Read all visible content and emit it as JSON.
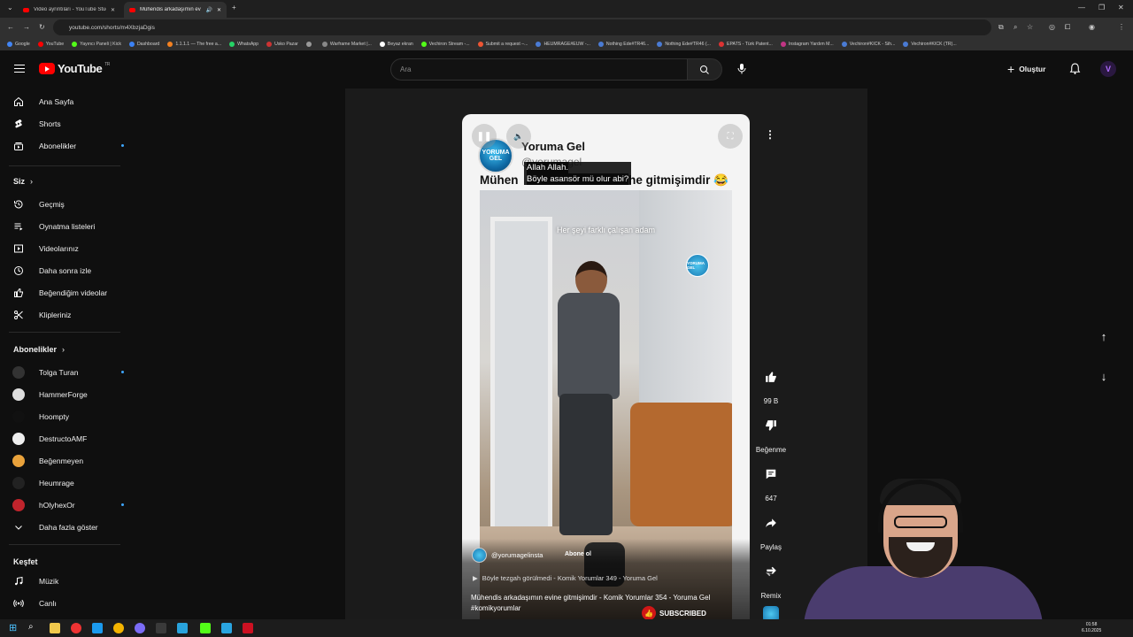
{
  "browser": {
    "tabs": [
      {
        "label": "Video ayrıntıları - YouTube Stud"
      },
      {
        "label": "Mühendis arkadaşımın evin"
      }
    ],
    "url": "youtube.com/shorts/m4XbzjaDgis",
    "bookmarks": [
      {
        "label": "Google",
        "color": "#4285f4"
      },
      {
        "label": "YouTube",
        "color": "#ff0000"
      },
      {
        "label": "Yayıncı Paneli | Kick",
        "color": "#53fc18"
      },
      {
        "label": "Dashboard",
        "color": "#3b82f6"
      },
      {
        "label": "1.1.1.1 — The free a...",
        "color": "#f48120"
      },
      {
        "label": "WhatsApp",
        "color": "#25d366"
      },
      {
        "label": "Usko Pazar",
        "color": "#c33"
      },
      {
        "label": "",
        "color": "#999"
      },
      {
        "label": "Warframe Market |...",
        "color": "#888"
      },
      {
        "label": "Beyaz ekran",
        "color": "#fff"
      },
      {
        "label": "Vechiron Stream -...",
        "color": "#53fc18"
      },
      {
        "label": "Submit a request –...",
        "color": "#e53"
      },
      {
        "label": "HEUMRAGE#EUW -...",
        "color": "#4a7bd4"
      },
      {
        "label": "Nothing Ede#TR46...",
        "color": "#4a7bd4"
      },
      {
        "label": "Nothing Ede#TR46 (...",
        "color": "#4a7bd4"
      },
      {
        "label": "EPATS - Türk Patent...",
        "color": "#d33"
      },
      {
        "label": "Instagram Yardım M...",
        "color": "#c13584"
      },
      {
        "label": "Vechiron#KICK - Sih...",
        "color": "#4a7bd4"
      },
      {
        "label": "Vechiron#KICK (TR)...",
        "color": "#4a7bd4"
      }
    ]
  },
  "header": {
    "logo_text": "YouTube",
    "region": "TR",
    "search_placeholder": "Ara",
    "create_label": "Oluştur",
    "avatar_letter": "V"
  },
  "sidebar": {
    "main": [
      {
        "label": "Ana Sayfa",
        "icon": "home-icon"
      },
      {
        "label": "Shorts",
        "icon": "shorts-icon"
      },
      {
        "label": "Abonelikler",
        "icon": "subscriptions-icon"
      }
    ],
    "you_heading": "Siz",
    "you": [
      {
        "label": "Geçmiş",
        "icon": "history-icon"
      },
      {
        "label": "Oynatma listeleri",
        "icon": "playlists-icon"
      },
      {
        "label": "Videolarınız",
        "icon": "your-videos-icon"
      },
      {
        "label": "Daha sonra izle",
        "icon": "watch-later-icon"
      },
      {
        "label": "Beğendiğim videolar",
        "icon": "liked-icon"
      },
      {
        "label": "Klipleriniz",
        "icon": "clips-icon"
      }
    ],
    "subs_heading": "Abonelikler",
    "subs": [
      {
        "label": "Tolga Turan",
        "color": "#333",
        "dot": true
      },
      {
        "label": "HammerForge",
        "color": "#ddd",
        "dot": false
      },
      {
        "label": "Hoompty",
        "color": "#111",
        "dot": false
      },
      {
        "label": "DestructoAMF",
        "color": "#eee",
        "dot": false
      },
      {
        "label": "Beğenmeyen",
        "color": "#e9a23b",
        "dot": false
      },
      {
        "label": "Heumrage",
        "color": "#222",
        "dot": false
      },
      {
        "label": "hOlyhexOr",
        "color": "#c0242c",
        "dot": true
      }
    ],
    "show_more": "Daha fazla göster",
    "explore_heading": "Keşfet",
    "explore": [
      {
        "label": "Müzik",
        "icon": "music-icon"
      },
      {
        "label": "Canlı",
        "icon": "live-icon"
      }
    ]
  },
  "short": {
    "channel_name": "Yoruma Gel",
    "channel_handle": "@yorumagel",
    "avatar_text": "YORUMA GEL",
    "title_left": "Mühen",
    "title_right": "he gitmişimdir 😂",
    "caption_line1": "Allah Allah.",
    "caption_line2": "Böyle asansör mü olur abi?",
    "overlay_text": "Her şeyi farklı çalışan adam",
    "watermark": "YORUMA GEL",
    "bottom_channel": "@yorumagelinsta",
    "bottom_subscribe": "Abone ol",
    "related": "Böyle tezgah görülmedi - Komik Yorumlar 349 - Yoruma Gel",
    "description": "Mühendis arkadaşımın evine gitmişimdir - Komik Yorumlar 354 - Yoruma Gel #komikyorumlar",
    "subscribed_badge": "SUBSCRIBED"
  },
  "actions": {
    "likes": "99 B",
    "dislike": "Beğenme",
    "comments": "647",
    "share": "Paylaş",
    "remix": "Remix"
  },
  "taskbar": {
    "time": "01:58",
    "date": "6.10.2025"
  }
}
